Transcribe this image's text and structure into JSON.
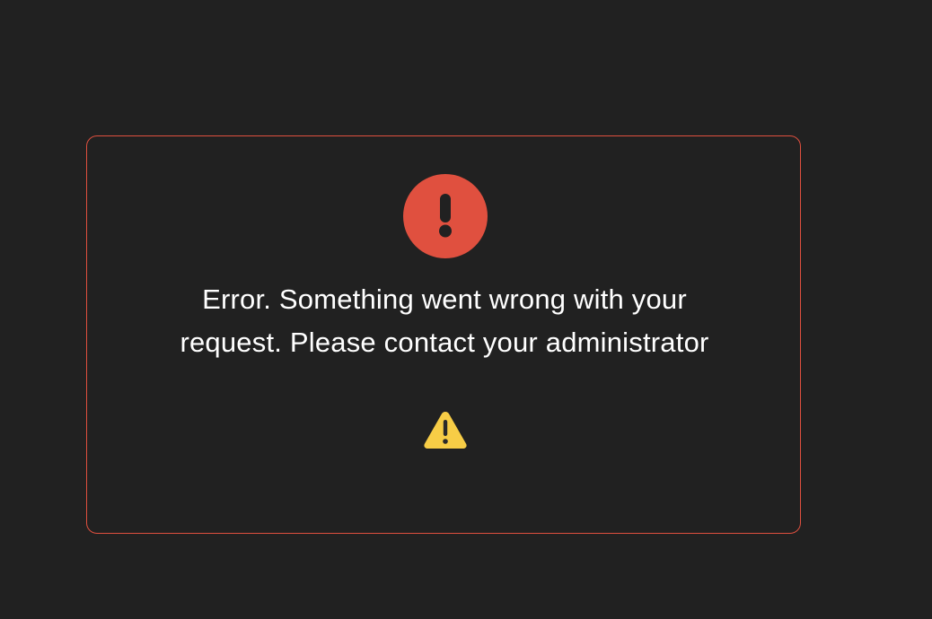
{
  "error_card": {
    "message_lines": [
      "Error. Something went wrong with your",
      "request. Please contact your administrator"
    ],
    "error_icon": "exclamation-circle-icon",
    "warning_icon": "warning-triangle-icon"
  },
  "colors": {
    "background": "#212121",
    "accent_error": "#e0503f",
    "text": "#ffffff",
    "warning": "#f7cd46"
  }
}
